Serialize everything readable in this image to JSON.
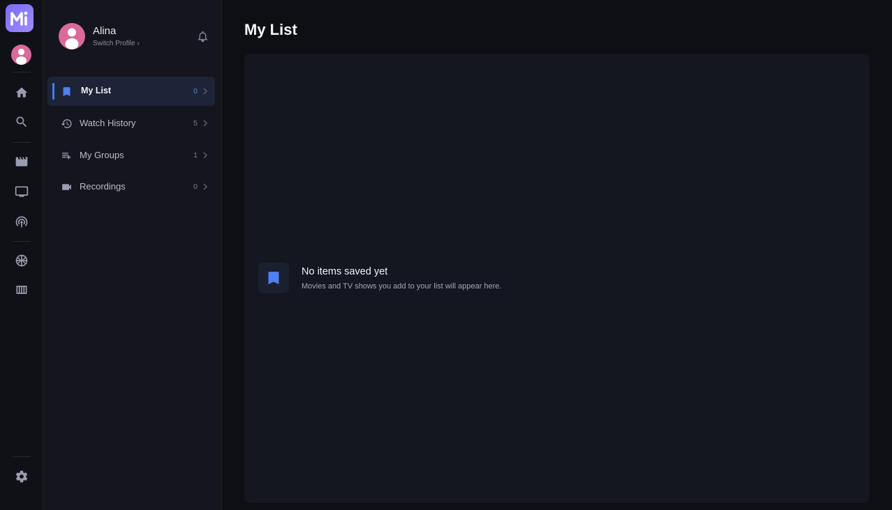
{
  "rail": {
    "logo_icon": "m-logo-icon",
    "items": [
      {
        "name": "home-icon"
      },
      {
        "name": "search-icon"
      },
      {
        "name": "movies-icon"
      },
      {
        "name": "tv-icon"
      },
      {
        "name": "live-icon"
      },
      {
        "name": "sports-icon"
      },
      {
        "name": "guide-icon"
      },
      {
        "name": "settings-icon"
      }
    ]
  },
  "profile": {
    "name": "Alina",
    "switch_label": "Switch Profile ›"
  },
  "nav": {
    "items": [
      {
        "label": "My List",
        "count": "0",
        "icon": "bookmark-icon",
        "active": true
      },
      {
        "label": "Watch History",
        "count": "5",
        "icon": "history-icon",
        "active": false
      },
      {
        "label": "My Groups",
        "count": "1",
        "icon": "playlist-icon",
        "active": false
      },
      {
        "label": "Recordings",
        "count": "0",
        "icon": "video-camera-icon",
        "active": false
      }
    ]
  },
  "main": {
    "title": "My List",
    "empty_title": "No items saved yet",
    "empty_subtitle": "Movies and TV shows you add to your list will appear here."
  },
  "colors": {
    "accent": "#4f7ff2",
    "avatar": "#d96a9a",
    "logo": "#8b7cf8",
    "background": "#0e0f14"
  }
}
